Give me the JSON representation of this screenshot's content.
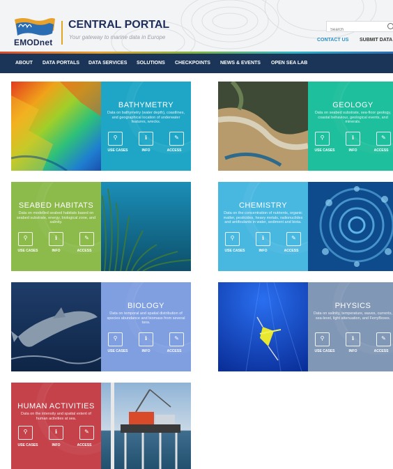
{
  "header": {
    "logo_text": "EMODnet",
    "title": "CENTRAL PORTAL",
    "tagline": "Your gateway to marine data in Europe",
    "search_placeholder": "Search",
    "contact_label": "CONTACT US",
    "submit_label": "SUBMIT DATA"
  },
  "nav": {
    "items": [
      {
        "label": "ABOUT"
      },
      {
        "label": "DATA PORTALS"
      },
      {
        "label": "DATA SERVICES"
      },
      {
        "label": "SOLUTIONS"
      },
      {
        "label": "CHECKPOINTS"
      },
      {
        "label": "NEWS & EVENTS"
      },
      {
        "label": "OPEN SEA LAB"
      }
    ]
  },
  "card_actions": {
    "use_cases": "USE CASES",
    "info": "INFO",
    "access": "ACCESS"
  },
  "cards": [
    {
      "title": "BATHYMETRY",
      "desc": "Data on bathymetry (water depth), coastlines, and geographical location of underwater features, wrecks.",
      "color": "#1fa6c6"
    },
    {
      "title": "GEOLOGY",
      "desc": "Data on seabed substrate, sea-floor geology, coastal behaviour, geological events, and minerals.",
      "color": "#1dbf9c"
    },
    {
      "title": "SEABED HABITATS",
      "desc": "Data on modelled seabed habitats based on seabed substrate, energy, biological zone, and salinity.",
      "color": "#8cbb4b"
    },
    {
      "title": "CHEMISTRY",
      "desc": "Data on the concentration of nutrients, organic matter, pesticides, heavy metals, radionuclides and antifoulants in water, sediment and biota.",
      "color": "#49b8e1"
    },
    {
      "title": "BIOLOGY",
      "desc": "Data on temporal and spatial distribution of species abundance and biomass from several taxa.",
      "color": "#7f9fe0"
    },
    {
      "title": "PHYSICS",
      "desc": "Data on salinity, temperature, waves, currents, sea-level, light attenuation, and FerryBoxes.",
      "color": "#8197b6"
    },
    {
      "title": "HUMAN ACTIVITIES",
      "desc": "Data on the intensity and spatial extent of human activities at sea.",
      "color": "#c5424a"
    }
  ]
}
